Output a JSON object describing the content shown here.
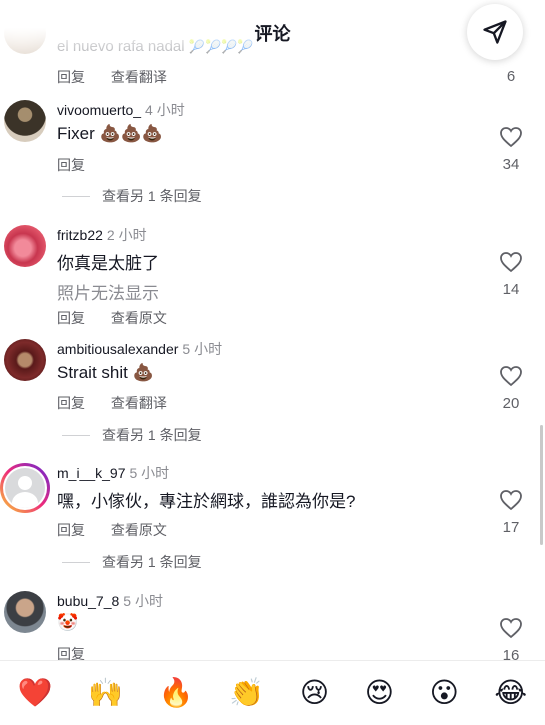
{
  "header": {
    "title": "评论"
  },
  "comments": [
    {
      "author": "",
      "time": "",
      "text": "el nuevo rafa nadal",
      "actions": [
        "回复",
        "查看翻译"
      ],
      "likes": "6",
      "more": ""
    },
    {
      "author": "vivoomuerto_",
      "time": "4 小时",
      "text": "Fixer 💩💩💩",
      "actions": [
        "回复"
      ],
      "likes": "34",
      "more": "查看另 1 条回复"
    },
    {
      "author": "fritzb22",
      "time": "2 小时",
      "text": "你真是太脏了",
      "subtext": "照片无法显示",
      "actions": [
        "回复",
        "查看原文"
      ],
      "likes": "14",
      "more": ""
    },
    {
      "author": "ambitiousalexander",
      "time": "5 小时",
      "text": "Strait shit 💩",
      "actions": [
        "回复",
        "查看翻译"
      ],
      "likes": "20",
      "more": "查看另 1 条回复"
    },
    {
      "author": "m_i__k_97",
      "time": "5 小时",
      "text": "嘿，小傢伙，專注於網球，誰認為你是?",
      "actions": [
        "回复",
        "查看原文"
      ],
      "likes": "17",
      "more": "查看另 1 条回复"
    },
    {
      "author": "bubu_7_8",
      "time": "5 小时",
      "text": "🤡",
      "actions": [
        "回复"
      ],
      "likes": "16",
      "more": ""
    }
  ],
  "emoji_bar": [
    "❤️",
    "🙌",
    "🔥",
    "👏",
    "😢",
    "😍",
    "😮",
    "😂"
  ]
}
